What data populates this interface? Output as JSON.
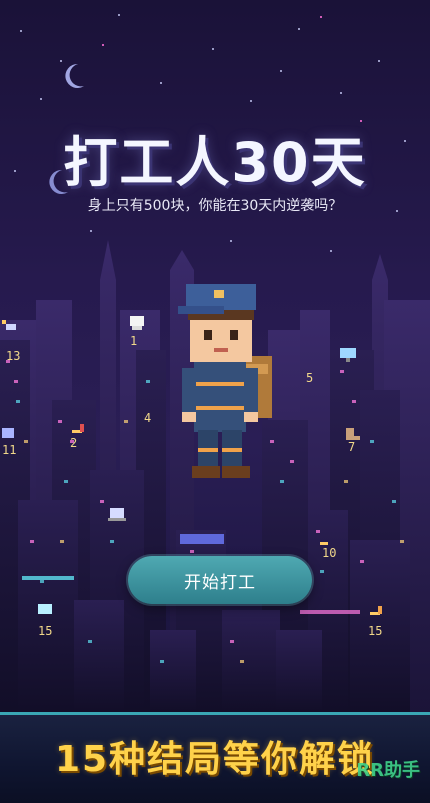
{
  "title": "打工人30天",
  "subtitle": "身上只有500块，你能在30天内逆袭吗？",
  "start_button": "开始打工",
  "footer_text": "15种结局等你解锁",
  "watermark": "RR助手",
  "building_numbers": [
    "13",
    "1",
    "11",
    "2",
    "4",
    "5",
    "7",
    "10",
    "15",
    "15"
  ],
  "colors": {
    "accent": "#3aa7b4",
    "footer_text": "#ffd24a",
    "button": "#3f95a0",
    "sky": "#221846"
  },
  "icons": [
    "moon-icon",
    "satellite-icon",
    "chef-hat-icon",
    "monitor-icon",
    "boot-icon",
    "brush-icon",
    "tv-icon",
    "laptop-icon"
  ]
}
